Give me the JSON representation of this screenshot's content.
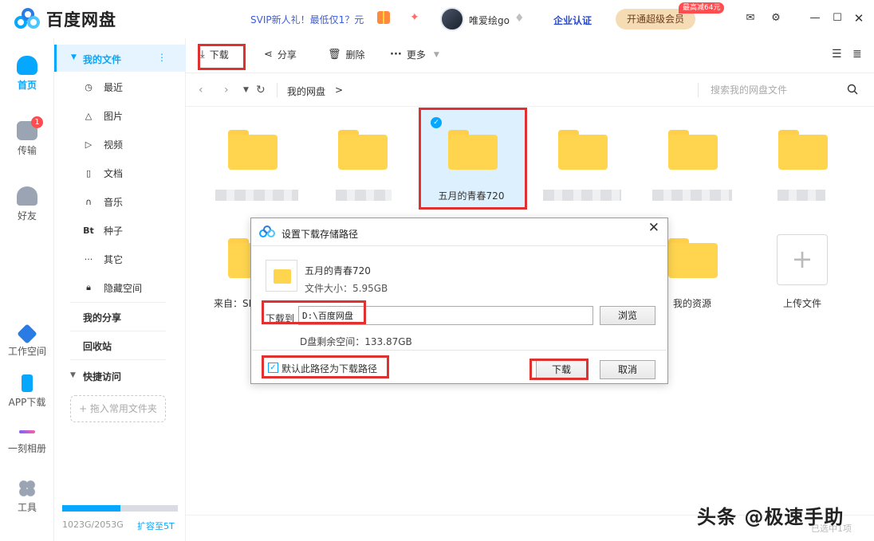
{
  "app": {
    "title": "百度网盘",
    "brand_color": "#06a7ff"
  },
  "header": {
    "svip_promo": "SVIP新人礼！最低仅1？元",
    "username": "唯爱绘go",
    "enterprise": "企业认证",
    "vip_button": "开通超级会员",
    "vip_badge": "最高减64元",
    "icons": [
      "gift-icon",
      "ai-icon",
      "diamond-icon",
      "mail-icon",
      "settings-icon",
      "minimize-icon",
      "maximize-icon",
      "close-icon"
    ]
  },
  "rail": {
    "items": [
      {
        "label": "首页",
        "icon": "cloud-icon",
        "active": true
      },
      {
        "label": "传输",
        "icon": "transfer-icon",
        "badge": "1"
      },
      {
        "label": "好友",
        "icon": "friends-icon"
      },
      {
        "label": "工作空间",
        "icon": "workspace-icon"
      },
      {
        "label": "APP下载",
        "icon": "phone-icon"
      },
      {
        "label": "一刻相册",
        "icon": "album-icon"
      },
      {
        "label": "工具",
        "icon": "tools-icon"
      }
    ]
  },
  "sidebar": {
    "head": "我的文件",
    "items": [
      {
        "label": "最近",
        "icon": "clock-icon"
      },
      {
        "label": "图片",
        "icon": "image-icon"
      },
      {
        "label": "视频",
        "icon": "play-icon"
      },
      {
        "label": "文档",
        "icon": "doc-icon"
      },
      {
        "label": "音乐",
        "icon": "headphones-icon"
      },
      {
        "label": "种子",
        "icon": "bt-icon"
      },
      {
        "label": "其它",
        "icon": "more-icon"
      },
      {
        "label": "隐藏空间",
        "icon": "lock-icon"
      }
    ],
    "my_share": "我的分享",
    "recycle": "回收站",
    "quick_access": "快捷访问",
    "drag_hint": "+ 拖入常用文件夹",
    "quota_text": "1023G/2053G",
    "quota_fraction": 0.5,
    "expand_link": "扩容至5T"
  },
  "toolbar": {
    "download": "下载",
    "share": "分享",
    "delete": "删除",
    "more": "更多"
  },
  "address": {
    "crumb": "我的网盘",
    "crumb_sep": ">",
    "search_placeholder": "搜索我的网盘文件"
  },
  "files": {
    "selected_name": "五月的青春720",
    "row2_first_prefix": "来自：SI",
    "resource_name": "我的资源",
    "upload_label": "上传文件"
  },
  "dialog": {
    "title": "设置下载存储路径",
    "file_name": "五月的青春720",
    "file_size": "文件大小：5.95GB",
    "download_to_label": "下载到",
    "path_value": "D:\\百度网盘",
    "browse": "浏览",
    "space_info": "D盘剩余空间：133.87GB",
    "default_path_label": "默认此路径为下载路径",
    "download_button": "下载",
    "cancel_button": "取消"
  },
  "status": {
    "selected_count": "已选中1项"
  },
  "watermark": "头条 @极速手助"
}
